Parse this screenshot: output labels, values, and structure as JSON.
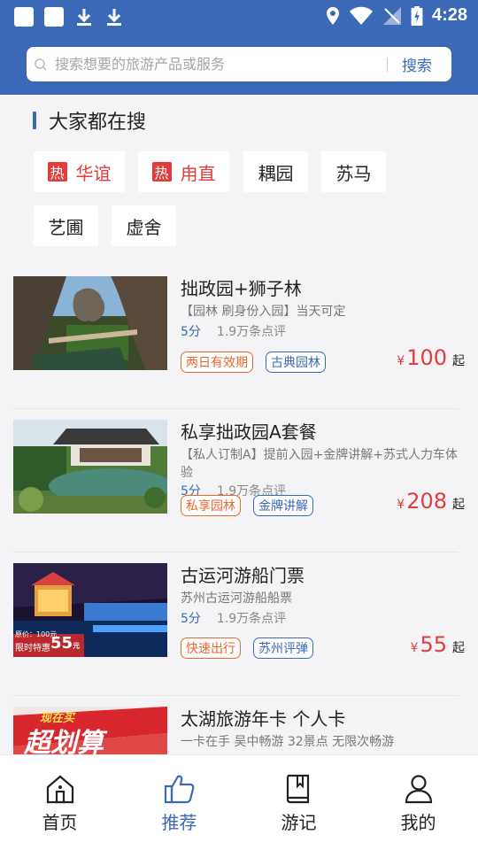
{
  "status_bar": {
    "time": "4:28"
  },
  "search": {
    "placeholder": "搜索想要的旅游产品或服务",
    "button": "搜索"
  },
  "hot_section": {
    "title": "大家都在搜",
    "hot_mark": "热",
    "tags": [
      {
        "label": "华谊",
        "hot": true
      },
      {
        "label": "甪直",
        "hot": true
      },
      {
        "label": "耦园",
        "hot": false
      },
      {
        "label": "苏马",
        "hot": false
      },
      {
        "label": "艺圃",
        "hot": false
      },
      {
        "label": "虚舍",
        "hot": false
      }
    ]
  },
  "products": [
    {
      "title": "拙政园+狮子林",
      "desc": "【园林 刷身份入园】当天可定",
      "score": "5分",
      "reviews": "1.9万条点评",
      "badges": [
        {
          "label": "两日有效期",
          "color": "orange"
        },
        {
          "label": "古典园林",
          "color": "blue"
        }
      ],
      "currency": "¥",
      "price": "100",
      "price_suffix": "起"
    },
    {
      "title": "私享拙政园A套餐",
      "desc": "【私人订制A】提前入园+金牌讲解+苏式人力车体验",
      "score": "5分",
      "reviews": "1.9万条点评",
      "badges": [
        {
          "label": "私享园林",
          "color": "orange"
        },
        {
          "label": "金牌讲解",
          "color": "blue"
        }
      ],
      "currency": "¥",
      "price": "208",
      "price_suffix": "起"
    },
    {
      "title": "古运河游船门票",
      "desc": "苏州古运河游船船票",
      "score": "5分",
      "reviews": "1.9万条点评",
      "badges": [
        {
          "label": "快速出行",
          "color": "orange"
        },
        {
          "label": "苏州评弹",
          "color": "blue"
        }
      ],
      "currency": "¥",
      "price": "55",
      "price_suffix": "起",
      "thumb_text": {
        "orig": "原价：100元",
        "special": "限时特惠",
        "special_price": "55",
        "unit": "元"
      }
    },
    {
      "title": "太湖旅游年卡 个人卡",
      "desc": "一卡在手 吴中畅游 32景点 无限次畅游",
      "thumb_text": {
        "line1": "现在买",
        "line2": "超划算"
      }
    }
  ],
  "bottom_nav": [
    {
      "label": "首页",
      "icon": "home-icon",
      "active": false
    },
    {
      "label": "推荐",
      "icon": "thumbs-up-icon",
      "active": true
    },
    {
      "label": "游记",
      "icon": "book-icon",
      "active": false
    },
    {
      "label": "我的",
      "icon": "user-icon",
      "active": false
    }
  ],
  "colors": {
    "primary": "#3b69b8",
    "hot": "#e23c3c",
    "orange": "#e8672d"
  }
}
